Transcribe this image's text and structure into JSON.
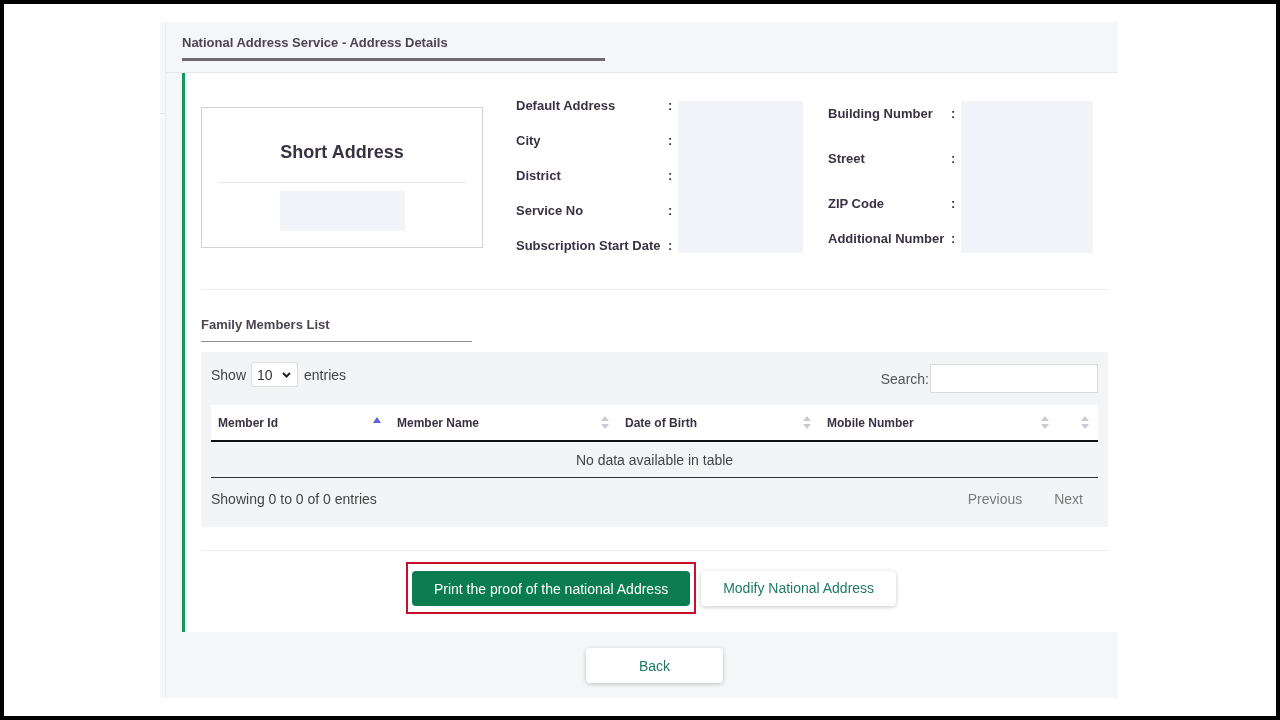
{
  "header": {
    "title": "National Address Service - Address Details"
  },
  "short_address": {
    "title": "Short Address"
  },
  "address_details": {
    "column_1": [
      {
        "label": "Default Address",
        "separator": ":"
      },
      {
        "label": "City",
        "separator": ":"
      },
      {
        "label": "District",
        "separator": ":"
      },
      {
        "label": "Service No",
        "separator": ":"
      },
      {
        "label": "Subscription Start Date",
        "separator": ":"
      }
    ],
    "column_2": [
      {
        "label": "Building Number",
        "separator": ":"
      },
      {
        "label": "Street",
        "separator": ":"
      },
      {
        "label": "ZIP Code",
        "separator": ":"
      },
      {
        "label": "Additional Number",
        "separator": ":"
      }
    ]
  },
  "family_members": {
    "title": "Family Members List",
    "length_menu": {
      "prefix": "Show",
      "value": "10",
      "suffix": "entries"
    },
    "search": {
      "label": "Search:"
    },
    "columns": [
      {
        "label": "Member Id",
        "sorted": true
      },
      {
        "label": "Member Name",
        "sorted": false
      },
      {
        "label": "Date of Birth",
        "sorted": false
      },
      {
        "label": "Mobile Number",
        "sorted": false
      },
      {
        "sorted": false
      }
    ],
    "empty_message": "No data available in table",
    "info": "Showing 0 to 0 of 0 entries",
    "pagination": [
      {
        "label": "Previous",
        "disabled": true
      },
      {
        "label": "Next",
        "disabled": true
      }
    ]
  },
  "actions": [
    {
      "label": "Print the proof of the national Address",
      "kind": "primary",
      "highlighted": true
    },
    {
      "label": "Modify National Address",
      "kind": "secondary",
      "highlighted": false
    }
  ],
  "back_button": {
    "label": "Back"
  }
}
